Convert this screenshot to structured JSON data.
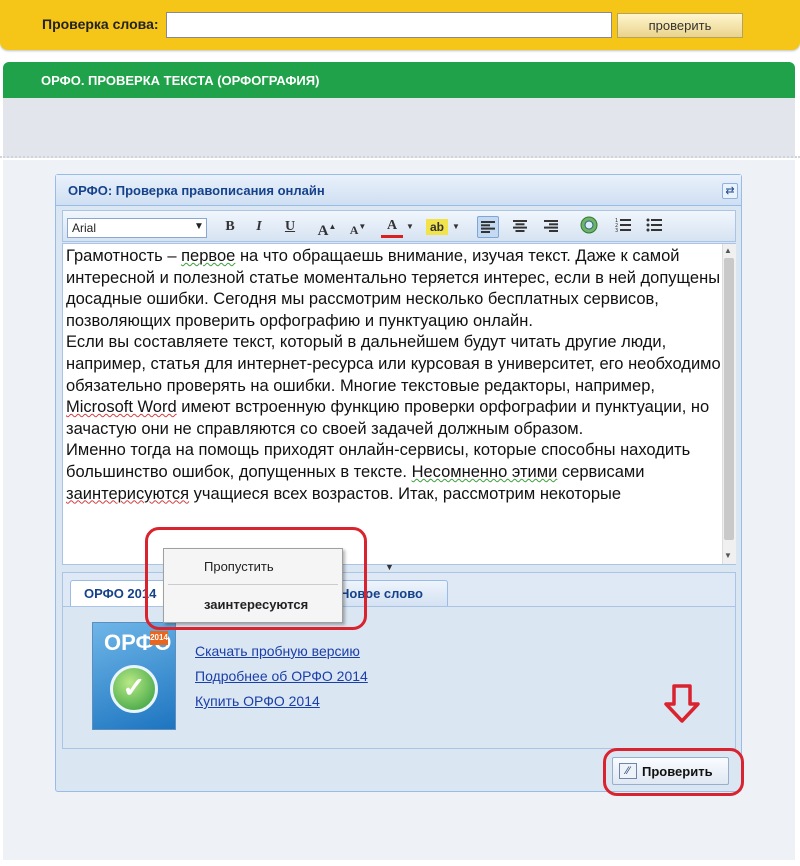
{
  "word_check": {
    "label": "Проверка слова:",
    "input_value": "",
    "button_label": "проверить"
  },
  "section": {
    "title": "ОРФО. ПРОВЕРКА ТЕКСТА (ОРФОГРАФИЯ)"
  },
  "window": {
    "title": "ОРФО: Проверка правописания онлайн",
    "tool_icon": "refresh-icon"
  },
  "toolbar": {
    "font": "Arial",
    "bold": "B",
    "italic": "I",
    "underline": "U",
    "grow": "A",
    "shrink": "A",
    "font_color": "A",
    "highlight": "ab",
    "icons": [
      "bold-icon",
      "italic-icon",
      "underline-icon",
      "font-grow-icon",
      "font-shrink-icon",
      "font-color-icon",
      "highlight-icon",
      "align-left-icon",
      "align-center-icon",
      "align-right-icon",
      "link-icon",
      "ordered-list-icon",
      "bullet-list-icon"
    ]
  },
  "editor": {
    "p1": {
      "a": "Грамотность – ",
      "b": "первое",
      "c": " на что обращаешь внимание, изучая текст. Даже к самой интересной и полезной статье моментально теряется интерес, если в ней допущены досадные ошибки. Сегодня мы рассмотрим несколько бесплатных сервисов, позволяющих проверить орфографию и пунктуацию онлайн."
    },
    "p2": {
      "a": "Если вы составляете текст, который в дальнейшем будут читать другие люди, например, статья для интернет-ресурса или курсовая в университет, его необходимо обязательно проверять на ошибки. Многие текстовые редакторы, например, ",
      "b": "Microsoft Word",
      "c": " имеют встроенную функцию проверки орфографии и пунктуации, но зачастую они не справляются со своей задачей должным образом."
    },
    "p3": {
      "a": "Именно тогда на помощь приходят онлайн-сервисы, которые способны находить большинство ошибок, допущенных в тексте. ",
      "b": "Несомненно этими",
      "c": " сервисами ",
      "d": "заинтерисуются",
      "e": " учащиеся всех возрастов. Итак, рассмотрим некоторые"
    }
  },
  "context_menu": {
    "skip": "Пропустить",
    "suggestion": "заинтересуются"
  },
  "tabs": [
    {
      "label": "ОРФО 2014",
      "active": true
    },
    {
      "label": "Новое слово",
      "active": false
    }
  ],
  "product": {
    "box_title": "ОРФО",
    "box_year": "2014"
  },
  "links": [
    "Скачать пробную версию",
    "Подробнее об ОРФО 2014",
    "Купить ОРФО 2014"
  ],
  "check_button": {
    "label": "Проверить"
  },
  "annotation": {
    "arrow": "⇩"
  },
  "colors": {
    "yellow_bar": "#f5c518",
    "green_bar": "#20a24a",
    "title_blue": "#15428b",
    "annotation_red": "#d9232e"
  }
}
